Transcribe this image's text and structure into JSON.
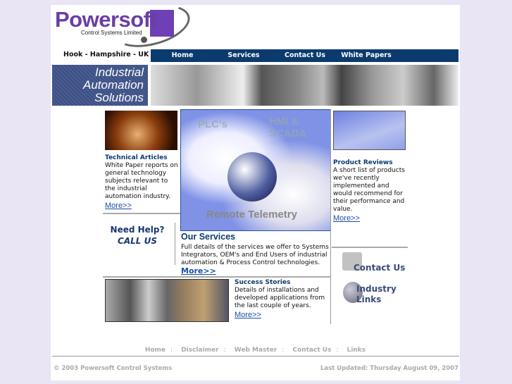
{
  "logo": {
    "name": "Powersoft",
    "subtitle": "Control Systems Limited"
  },
  "location": "Hook - Hampshire - UK",
  "nav": [
    "Home",
    "Services",
    "Contact Us",
    "White Papers"
  ],
  "banner": {
    "line1": "Industrial",
    "line2": "Automation",
    "line3": "Solutions"
  },
  "technical": {
    "title": "Technical Articles",
    "text": "White Paper  reports on general technology subjects relevant to the industrial automation industry.",
    "more": "More>>"
  },
  "help": {
    "line1": "Need Help?",
    "line2": "CALL US"
  },
  "services_image": {
    "labels": [
      "PLC's",
      "HMI & SCADA",
      "Remote Telemetry"
    ]
  },
  "services": {
    "title": "Our Services",
    "text": "Full details of the services we offer to Systems Integrators, OEM's and End Users of industrial automation & Process Control technologies.",
    "more": "More>>"
  },
  "reviews": {
    "title": "Product Reviews",
    "text": "A short list of products we've recently implemented and would recommend for their performance and value.",
    "more": "More>>"
  },
  "contact_link": "Contact Us",
  "industry_link": "Industry Links",
  "success": {
    "title": "Success Stories",
    "text": "Details of installations and developed applications from the last couple of years.",
    "more": "More>>"
  },
  "footer": {
    "links": [
      "Home",
      "Disclaimer",
      "Web Master",
      "Contact Us",
      "Links"
    ],
    "copyright": "© 2003 Powersoft Control Systems",
    "updated": "Last Updated: Thursday August 09, 2007"
  }
}
